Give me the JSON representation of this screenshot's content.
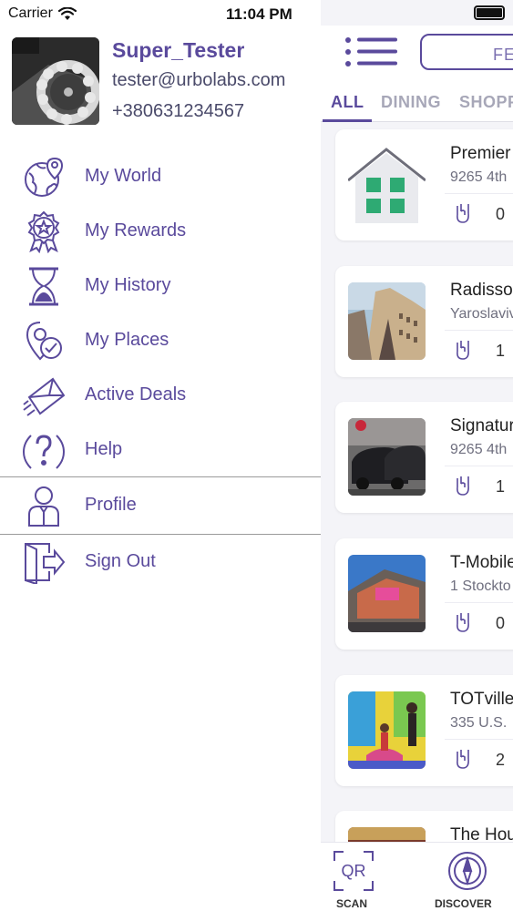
{
  "status_bar": {
    "carrier": "Carrier",
    "time": "11:04 PM"
  },
  "user": {
    "name": "Super_Tester",
    "email": "tester@urbolabs.com",
    "phone": "+380631234567"
  },
  "menu": [
    {
      "label": "My World",
      "icon": "globe-pin-icon"
    },
    {
      "label": "My Rewards",
      "icon": "award-badge-icon"
    },
    {
      "label": "My History",
      "icon": "hourglass-icon"
    },
    {
      "label": "My Places",
      "icon": "map-pin-check-icon"
    },
    {
      "label": "Active Deals",
      "icon": "envelope-send-icon"
    },
    {
      "label": "Help",
      "icon": "help-circle-icon"
    },
    {
      "label": "Profile",
      "icon": "user-icon"
    },
    {
      "label": "Sign Out",
      "icon": "sign-out-icon"
    }
  ],
  "topbar": {
    "feed_label": "FE"
  },
  "tabs": [
    {
      "label": "ALL",
      "active": true
    },
    {
      "label": "DINING",
      "active": false
    },
    {
      "label": "SHOPP",
      "active": false
    }
  ],
  "places": [
    {
      "title": "Premier",
      "address": "9265 4th",
      "count": "0"
    },
    {
      "title": "Radisso",
      "address": "Yaroslaviv",
      "count": "1"
    },
    {
      "title": "Signatur",
      "address": "9265 4th",
      "count": "1"
    },
    {
      "title": "T-Mobile",
      "address": "1 Stockto",
      "count": "0"
    },
    {
      "title": "TOTville",
      "address": "335 U.S.",
      "count": "2"
    },
    {
      "title": "The Hou",
      "address": "",
      "count": ""
    }
  ],
  "bottom_nav": {
    "scan_label": "SCAN",
    "discover_label": "DISCOVER",
    "qr_text": "QR"
  },
  "colors": {
    "accent": "#5a4a9c",
    "muted": "#a7a7b8",
    "house_green": "#2eaa73"
  }
}
